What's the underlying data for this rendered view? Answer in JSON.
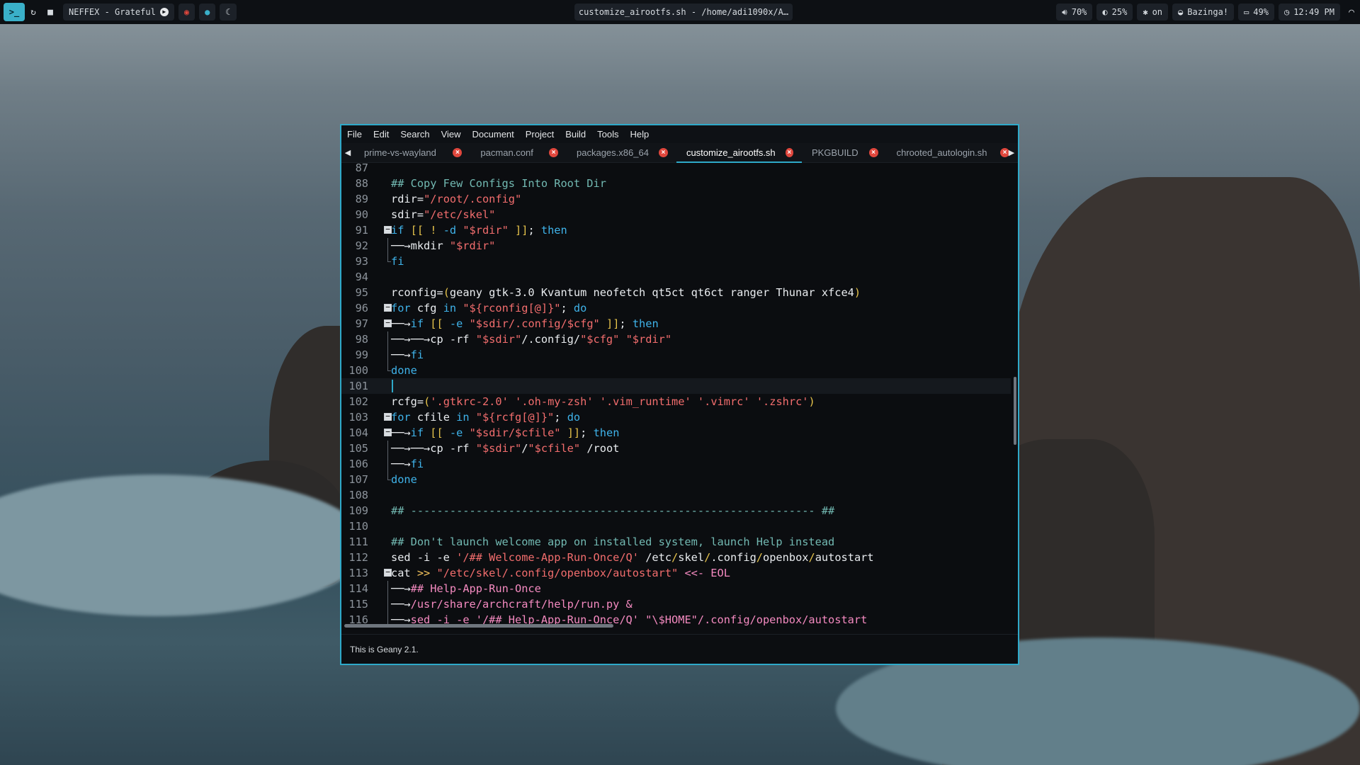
{
  "panel": {
    "launcher_icon": "terminal-icon",
    "icons": [
      "refresh-icon",
      "folder-icon"
    ],
    "music": "NEFFEX - Grateful",
    "music_icon": "play-icon",
    "window_title": "customize_airootfs.sh - /home/adi1090x/A…",
    "volume": "70%",
    "brightness": "25%",
    "bluetooth": "on",
    "wifi": "Bazinga!",
    "battery": "49%",
    "clock": "12:49 PM"
  },
  "menu": [
    "File",
    "Edit",
    "Search",
    "View",
    "Document",
    "Project",
    "Build",
    "Tools",
    "Help"
  ],
  "tabs": [
    {
      "label": "prime-vs-wayland",
      "active": false
    },
    {
      "label": "pacman.conf",
      "active": false
    },
    {
      "label": "packages.x86_64",
      "active": false
    },
    {
      "label": "customize_airootfs.sh",
      "active": true
    },
    {
      "label": "PKGBUILD",
      "active": false
    },
    {
      "label": "chrooted_autologin.sh",
      "active": false
    }
  ],
  "lines": [
    {
      "n": "87",
      "fold": "",
      "h": ""
    },
    {
      "n": "88",
      "fold": "",
      "h": "<span class=\"c\">## Copy Few Configs Into Root Dir</span>"
    },
    {
      "n": "89",
      "fold": "",
      "h": "rdir=<span class=\"s\">\"/root/.config\"</span>"
    },
    {
      "n": "90",
      "fold": "",
      "h": "sdir=<span class=\"s\">\"/etc/skel\"</span>"
    },
    {
      "n": "91",
      "fold": "box",
      "h": "<span class=\"k\">if</span> <span class=\"o\">[[ ! </span><span class=\"k\">-d</span> <span class=\"s\">\"$rdir\"</span> <span class=\"o\">]]</span>; <span class=\"k\">then</span>"
    },
    {
      "n": "92",
      "fold": "line",
      "h": "──→mkdir <span class=\"s\">\"$rdir\"</span>"
    },
    {
      "n": "93",
      "fold": "end",
      "h": "<span class=\"k\">fi</span>"
    },
    {
      "n": "94",
      "fold": "",
      "h": ""
    },
    {
      "n": "95",
      "fold": "",
      "h": "rconfig=<span class=\"o\">(</span>geany gtk-3.0 Kvantum neofetch qt5ct qt6ct ranger Thunar xfce4<span class=\"o\">)</span>"
    },
    {
      "n": "96",
      "fold": "box",
      "h": "<span class=\"k\">for</span> cfg <span class=\"k\">in</span> <span class=\"s\">\"${rconfig[@]}\"</span>; <span class=\"k\">do</span>"
    },
    {
      "n": "97",
      "fold": "box",
      "h": "──→<span class=\"k\">if</span> <span class=\"o\">[[ </span><span class=\"k\">-e</span> <span class=\"s\">\"$sdir/.config/$cfg\"</span> <span class=\"o\">]]</span>; <span class=\"k\">then</span>"
    },
    {
      "n": "98",
      "fold": "line",
      "h": "──→──→cp -rf <span class=\"s\">\"$sdir\"</span>/.config/<span class=\"s\">\"$cfg\"</span> <span class=\"s\">\"$rdir\"</span>"
    },
    {
      "n": "99",
      "fold": "line",
      "h": "──→<span class=\"k\">fi</span>"
    },
    {
      "n": "100",
      "fold": "end",
      "h": "<span class=\"k\">done</span>"
    },
    {
      "n": "101",
      "fold": "",
      "h": "",
      "cur": true
    },
    {
      "n": "102",
      "fold": "",
      "h": "rcfg=<span class=\"o\">(</span><span class=\"s\">'.gtkrc-2.0'</span> <span class=\"s\">'.oh-my-zsh'</span> <span class=\"s\">'.vim_runtime'</span> <span class=\"s\">'.vimrc'</span> <span class=\"s\">'.zshrc'</span><span class=\"o\">)</span>"
    },
    {
      "n": "103",
      "fold": "box",
      "h": "<span class=\"k\">for</span> cfile <span class=\"k\">in</span> <span class=\"s\">\"${rcfg[@]}\"</span>; <span class=\"k\">do</span>"
    },
    {
      "n": "104",
      "fold": "box",
      "h": "──→<span class=\"k\">if</span> <span class=\"o\">[[ </span><span class=\"k\">-e</span> <span class=\"s\">\"$sdir/$cfile\"</span> <span class=\"o\">]]</span>; <span class=\"k\">then</span>"
    },
    {
      "n": "105",
      "fold": "line",
      "h": "──→──→cp -rf <span class=\"s\">\"$sdir\"</span>/<span class=\"s\">\"$cfile\"</span> /root"
    },
    {
      "n": "106",
      "fold": "line",
      "h": "──→<span class=\"k\">fi</span>"
    },
    {
      "n": "107",
      "fold": "end",
      "h": "<span class=\"k\">done</span>"
    },
    {
      "n": "108",
      "fold": "",
      "h": ""
    },
    {
      "n": "109",
      "fold": "",
      "h": "<span class=\"c\">## -------------------------------------------------------------- ##</span>"
    },
    {
      "n": "110",
      "fold": "",
      "h": ""
    },
    {
      "n": "111",
      "fold": "",
      "h": "<span class=\"c\">## Don't launch welcome app on installed system, launch Help instead</span>"
    },
    {
      "n": "112",
      "fold": "",
      "h": "sed -i -e <span class=\"s\">'/## Welcome-App-Run-Once/Q'</span> /etc<span class=\"o\">/</span>skel<span class=\"o\">/</span>.config<span class=\"o\">/</span>openbox<span class=\"o\">/</span>autostart"
    },
    {
      "n": "113",
      "fold": "box",
      "h": "cat <span class=\"v\">&gt;&gt;</span> <span class=\"s\">\"/etc/skel/.config/openbox/autostart\"</span> <span class=\"p\">&lt;&lt;- EOL</span>"
    },
    {
      "n": "114",
      "fold": "line",
      "h": "──→<span class=\"p\">## Help-App-Run-Once</span>"
    },
    {
      "n": "115",
      "fold": "line",
      "h": "──→<span class=\"p\">/usr/share/archcraft/help/run.py &amp;</span>"
    },
    {
      "n": "116",
      "fold": "line",
      "h": "──→<span class=\"p\">sed -i -e '/## Help-App-Run-Once/Q' \"\\$HOME\"/.config/openbox/autostart</span>"
    }
  ],
  "status": "This is Geany 2.1."
}
